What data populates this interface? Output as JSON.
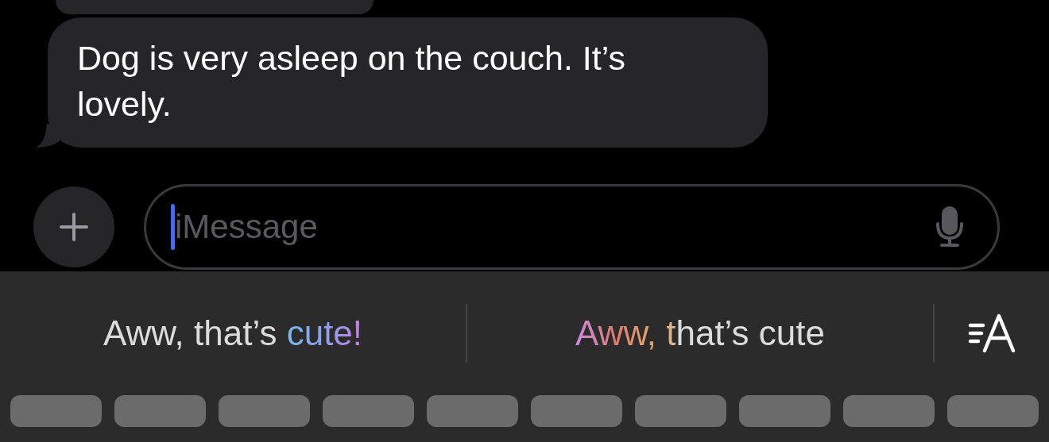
{
  "messages": [
    {
      "text": "Dog is very asleep on the couch. It’s lovely."
    }
  ],
  "composer": {
    "placeholder": "iMessage",
    "focused": true
  },
  "suggestions": [
    {
      "segments": [
        {
          "text": "Aww, that’s ",
          "highlighted": false
        },
        {
          "text": "cute!",
          "highlighted": true
        }
      ]
    },
    {
      "segments": [
        {
          "text": "Aww, t",
          "highlighted": true
        },
        {
          "text": "hat’s cute",
          "highlighted": false
        }
      ]
    }
  ]
}
